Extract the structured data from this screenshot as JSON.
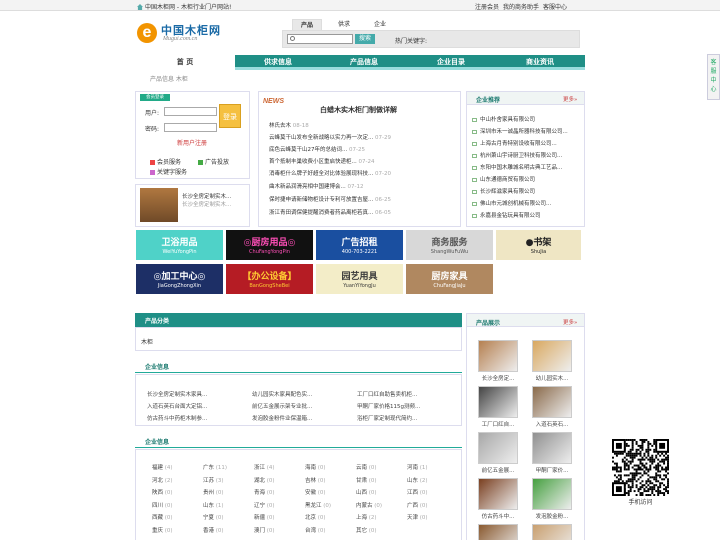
{
  "topbar": {
    "left": "中国木柜网 - 木柜行业门户网站!",
    "links": [
      "注册会员",
      "我的商务助手",
      "客服中心"
    ]
  },
  "logo": {
    "cn": "中国木柜网",
    "en": "Mugui.com.cn",
    "mark": "e"
  },
  "search": {
    "tabs": [
      "产品",
      "供求",
      "企业"
    ],
    "placeholder": "",
    "button": "搜索",
    "hot": "热门关键字:"
  },
  "nav": [
    "首 页",
    "供求信息",
    "产品信息",
    "企业目录",
    "商业资讯"
  ],
  "breadcrumb": "产品信息 木柜",
  "login": {
    "badge": "会员登录",
    "user_label": "用户:",
    "pass_label": "密码:",
    "button": "登录",
    "register": "新用户注册",
    "services": [
      "会员服务",
      "广告投放",
      "关键字服务"
    ]
  },
  "left_promo": {
    "title": "长沙全房定制实木...",
    "sub": "长沙全房定制实木..."
  },
  "news": {
    "label": "NEWS",
    "headline": "白蜡木实木柜门制做详解",
    "items": [
      {
        "t": "林氏去木",
        "d": "08-18"
      },
      {
        "t": "云峰莫干山发布全新战略以实力再一次定...",
        "d": "07-29"
      },
      {
        "t": "底色云峰莫干山27年的总结词...",
        "d": "07-25"
      },
      {
        "t": "首个抵制丰巢收费小区重启快递柜...",
        "d": "07-24"
      },
      {
        "t": "消毒柜什么牌子好超全对比体验展现科技...",
        "d": "07-20"
      },
      {
        "t": "曲木新品润滑亮相中国建博会...",
        "d": "07-12"
      },
      {
        "t": "保时捷申请新储物柜设计专利可放置吉屋...",
        "d": "06-25"
      },
      {
        "t": "浙江青田调保健提醒消费者药品离柜若真...",
        "d": "06-05"
      }
    ]
  },
  "recommend": {
    "title": "企业推荐",
    "more": "更多»",
    "items": [
      "中山朴舍家具有限公司",
      "深圳市禾一诚晶所器科技有限公司...",
      "上海古月青特别设收有限公司...",
      "杭州萧山宇诗厨卫科技有限公司...",
      "东阳中国木雕城名明古典工艺品...",
      "山东通德商贸有限公司",
      "长沙辉滋家具有限公司",
      "佛山市元城创机械有限公司...",
      "永嘉县金钻玩具有限公司"
    ]
  },
  "banners": [
    {
      "cn": "卫浴用品",
      "en": "WeiYuYongPin",
      "bg": "#4fd2c8",
      "fg": "#ffffff"
    },
    {
      "cn": "◎厨房用品◎",
      "en": "ChuFangYongPin",
      "bg": "#111111",
      "fg": "#ff4fb8"
    },
    {
      "cn": "广告招租",
      "en": "400-703-2221",
      "bg": "#1a4fa0",
      "fg": "#ffffff"
    },
    {
      "cn": "商务服务",
      "en": "ShangWuFuWu",
      "bg": "#d8d8d8",
      "fg": "#555555"
    },
    {
      "cn": "●书架",
      "en": "ShuJia",
      "bg": "#efe6c4",
      "fg": "#222222"
    },
    {
      "cn": "◎加工中心◎",
      "en": "JiaGongZhongXin",
      "bg": "#1d2f66",
      "fg": "#ffffff"
    },
    {
      "cn": "【办公设备】",
      "en": "BanGongSheBei",
      "bg": "#b51c24",
      "fg": "#ffcc33"
    },
    {
      "cn": "园艺用具",
      "en": "YuanYiYongJu",
      "bg": "#f3edc8",
      "fg": "#3a3a3a"
    },
    {
      "cn": "厨房家具",
      "en": "ChuFangJiaJu",
      "bg": "#b08860",
      "fg": "#ffffff"
    }
  ],
  "category": {
    "title": "产品分类",
    "item": "木柜"
  },
  "company": {
    "title": "企业信息",
    "items": [
      "长沙全房定制实木家具...",
      "幼儿园实木家具配色实...",
      "工厂口红自助售卖机柜...",
      "入道石英石台面大定铝...",
      "前亿五金展示架专业批...",
      "甲酮厂家价格115g测频...",
      "仿古药斗中药柜木制参...",
      "发泡胶金粉件业保温箱...",
      "浴柜厂家定制现代简约..."
    ]
  },
  "region": {
    "title": "企业信息",
    "items": [
      {
        "n": "福建",
        "c": "(4)"
      },
      {
        "n": "广东",
        "c": "(11)"
      },
      {
        "n": "浙江",
        "c": "(4)"
      },
      {
        "n": "海南",
        "c": "(0)"
      },
      {
        "n": "云南",
        "c": "(0)"
      },
      {
        "n": "河南",
        "c": "(1)"
      },
      {
        "n": "河北",
        "c": "(2)"
      },
      {
        "n": "江苏",
        "c": "(3)"
      },
      {
        "n": "湖北",
        "c": "(0)"
      },
      {
        "n": "吉林",
        "c": "(0)"
      },
      {
        "n": "甘肃",
        "c": "(0)"
      },
      {
        "n": "山东",
        "c": "(2)"
      },
      {
        "n": "陕西",
        "c": "(0)"
      },
      {
        "n": "贵州",
        "c": "(0)"
      },
      {
        "n": "青海",
        "c": "(0)"
      },
      {
        "n": "安徽",
        "c": "(0)"
      },
      {
        "n": "山西",
        "c": "(0)"
      },
      {
        "n": "江西",
        "c": "(0)"
      },
      {
        "n": "四川",
        "c": "(0)"
      },
      {
        "n": "山东",
        "c": "(1)"
      },
      {
        "n": "辽宁",
        "c": "(0)"
      },
      {
        "n": "黑龙江",
        "c": "(0)"
      },
      {
        "n": "内蒙古",
        "c": "(0)"
      },
      {
        "n": "广西",
        "c": "(0)"
      },
      {
        "n": "西藏",
        "c": "(0)"
      },
      {
        "n": "宁夏",
        "c": "(0)"
      },
      {
        "n": "新疆",
        "c": "(0)"
      },
      {
        "n": "北京",
        "c": "(0)"
      },
      {
        "n": "上海",
        "c": "(2)"
      },
      {
        "n": "天津",
        "c": "(0)"
      },
      {
        "n": "重庆",
        "c": "(0)"
      },
      {
        "n": "香港",
        "c": "(0)"
      },
      {
        "n": "澳门",
        "c": "(0)"
      },
      {
        "n": "台湾",
        "c": "(0)"
      },
      {
        "n": "其它",
        "c": "(0)"
      }
    ]
  },
  "products": {
    "title": "产品展示",
    "more": "更多»",
    "items": [
      {
        "n": "长沙全房定...",
        "c": "#b58050"
      },
      {
        "n": "幼儿园实木...",
        "c": "#d9a860"
      },
      {
        "n": "工厂口红自...",
        "c": "#444444"
      },
      {
        "n": "入道石英石...",
        "c": "#8a6a4a"
      },
      {
        "n": "前亿五金展...",
        "c": "#a8a8a8"
      },
      {
        "n": "甲酮厂家价...",
        "c": "#909090"
      },
      {
        "n": "仿古药斗中...",
        "c": "#7a3f20"
      },
      {
        "n": "发泡胶金粉...",
        "c": "#46a040"
      },
      {
        "n": "",
        "c": "#8a5a30"
      },
      {
        "n": "",
        "c": "#c9a070"
      }
    ]
  },
  "qr": {
    "caption": "手机访问"
  },
  "kefu": "客服中心"
}
